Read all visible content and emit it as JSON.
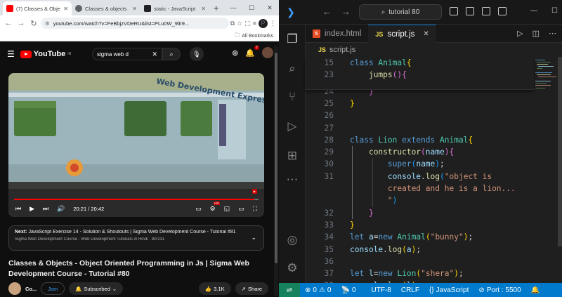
{
  "chrome": {
    "tabs": [
      {
        "title": "(7) Classes & Obje",
        "favicon_color": "#ff0000",
        "active": true
      },
      {
        "title": "Classes & objects",
        "favicon_color": "#5f6368",
        "active": false
      },
      {
        "title": "static - JavaScript",
        "favicon_color": "#202124",
        "active": false
      }
    ],
    "new_tab_label": "+",
    "url": "youtube.com/watch?v=FeBbjzVDeRU&list=PLu0W_9lII9...",
    "profile_initial": "P",
    "bookmarks_label": "All Bookmarks"
  },
  "youtube": {
    "logo_text": "YouTube",
    "logo_region": "IN",
    "search_value": "sigma web d",
    "notification_count": "7",
    "player": {
      "time_current": "20:21",
      "time_total": "20:42",
      "progress_fraction": 0.983,
      "coach_text": "Web Development Express"
    },
    "next_card": {
      "label": "Next:",
      "title": "JavaScript Exercise 14 - Solution & Shoutouts | Sigma Web Development Course - Tutorial #81",
      "playlist": "Sigma Web Development Course - Web Development Tutorials in Hindi",
      "position": "80/131"
    },
    "video_title": "Classes & Objects - Object Oriented Programming in Js | Sigma Web Development Course - Tutorial #80",
    "channel_short": "Co...",
    "join_label": "Join",
    "subscribed_label": "Subscribed",
    "likes": "3.1K",
    "share_label": "Share"
  },
  "vscode": {
    "command_center": "tutorial 80",
    "tabs": [
      {
        "label": "index.html",
        "icon": "html5-icon",
        "active": false
      },
      {
        "label": "script.js",
        "icon": "js-icon",
        "active": true
      }
    ],
    "breadcrumb": "script.js",
    "code_lines": [
      {
        "num": "15",
        "sticky": true,
        "tokens": [
          [
            "kw",
            "class "
          ],
          [
            "cls",
            "Animal"
          ],
          [
            "b1",
            "{"
          ]
        ]
      },
      {
        "num": "23",
        "sticky": true,
        "tokens": [
          [
            "pl",
            "    "
          ],
          [
            "fn",
            "jumps"
          ],
          [
            "b2",
            "()"
          ],
          [
            "b2",
            "{"
          ]
        ]
      },
      {
        "num": "24",
        "tokens": [
          [
            "pl",
            "    "
          ],
          [
            "b2",
            "}"
          ]
        ]
      },
      {
        "num": "25",
        "tokens": [
          [
            "b1",
            "}"
          ]
        ]
      },
      {
        "num": "26",
        "tokens": []
      },
      {
        "num": "27",
        "tokens": []
      },
      {
        "num": "28",
        "tokens": [
          [
            "kw",
            "class "
          ],
          [
            "cls",
            "Lion "
          ],
          [
            "kw",
            "extends "
          ],
          [
            "cls",
            "Animal"
          ],
          [
            "b1",
            "{"
          ]
        ]
      },
      {
        "num": "29",
        "tokens": [
          [
            "pl",
            "    "
          ],
          [
            "fn",
            "constructor"
          ],
          [
            "b2",
            "("
          ],
          [
            "vr",
            "name"
          ],
          [
            "b2",
            ")"
          ],
          [
            "b2",
            "{"
          ]
        ]
      },
      {
        "num": "30",
        "tokens": [
          [
            "pl",
            "        "
          ],
          [
            "kw",
            "super"
          ],
          [
            "b3",
            "("
          ],
          [
            "vr",
            "name"
          ],
          [
            "b3",
            ")"
          ],
          [
            "pl",
            ";"
          ]
        ]
      },
      {
        "num": "31",
        "tokens": [
          [
            "pl",
            "        "
          ],
          [
            "vr",
            "console"
          ],
          [
            "pl",
            "."
          ],
          [
            "fn",
            "log"
          ],
          [
            "b3",
            "("
          ],
          [
            "str",
            "\"object is"
          ]
        ]
      },
      {
        "num": "",
        "tokens": [
          [
            "pl",
            "        "
          ],
          [
            "str",
            "created and he is a lion..."
          ]
        ]
      },
      {
        "num": "",
        "tokens": [
          [
            "pl",
            "        "
          ],
          [
            "str",
            "\""
          ],
          [
            "b3",
            ")"
          ]
        ]
      },
      {
        "num": "32",
        "tokens": [
          [
            "pl",
            "    "
          ],
          [
            "b2",
            "}"
          ]
        ]
      },
      {
        "num": "33",
        "tokens": [
          [
            "b1",
            "}"
          ]
        ]
      },
      {
        "num": "34",
        "tokens": [
          [
            "kw",
            "let "
          ],
          [
            "vr",
            "a"
          ],
          [
            "pl",
            "="
          ],
          [
            "kw",
            "new "
          ],
          [
            "cls",
            "Animal"
          ],
          [
            "b1",
            "("
          ],
          [
            "str",
            "\"bunny\""
          ],
          [
            "b1",
            ")"
          ],
          [
            "pl",
            ";"
          ]
        ]
      },
      {
        "num": "35",
        "tokens": [
          [
            "vr",
            "console"
          ],
          [
            "pl",
            "."
          ],
          [
            "fn",
            "log"
          ],
          [
            "b1",
            "("
          ],
          [
            "vr",
            "a"
          ],
          [
            "b1",
            ")"
          ],
          [
            "pl",
            ";"
          ]
        ]
      },
      {
        "num": "36",
        "tokens": []
      },
      {
        "num": "37",
        "tokens": [
          [
            "kw",
            "let "
          ],
          [
            "vr",
            "l"
          ],
          [
            "pl",
            "="
          ],
          [
            "kw",
            "new "
          ],
          [
            "cls",
            "Lion"
          ],
          [
            "b1",
            "("
          ],
          [
            "str",
            "\"shera\""
          ],
          [
            "b1",
            ")"
          ],
          [
            "pl",
            ";"
          ]
        ]
      },
      {
        "num": "38",
        "tokens": [
          [
            "vr",
            "console"
          ],
          [
            "pl",
            "."
          ],
          [
            "fn",
            "log"
          ],
          [
            "b1",
            "("
          ],
          [
            "vr",
            "l"
          ],
          [
            "b1",
            ")"
          ],
          [
            "pl",
            ";"
          ]
        ]
      }
    ],
    "status": {
      "errors": "0",
      "warnings": "0",
      "ports": "0",
      "encoding": "UTF-8",
      "eol": "CRLF",
      "language": "JavaScript",
      "port_label": "Port : 5500"
    },
    "colors": {
      "statusbar": "#007acc",
      "remote": "#16825d",
      "keyword": "#569cd6",
      "class": "#4ec9b0",
      "function": "#dcdcaa",
      "variable": "#9cdcfe",
      "string": "#ce9178"
    }
  }
}
